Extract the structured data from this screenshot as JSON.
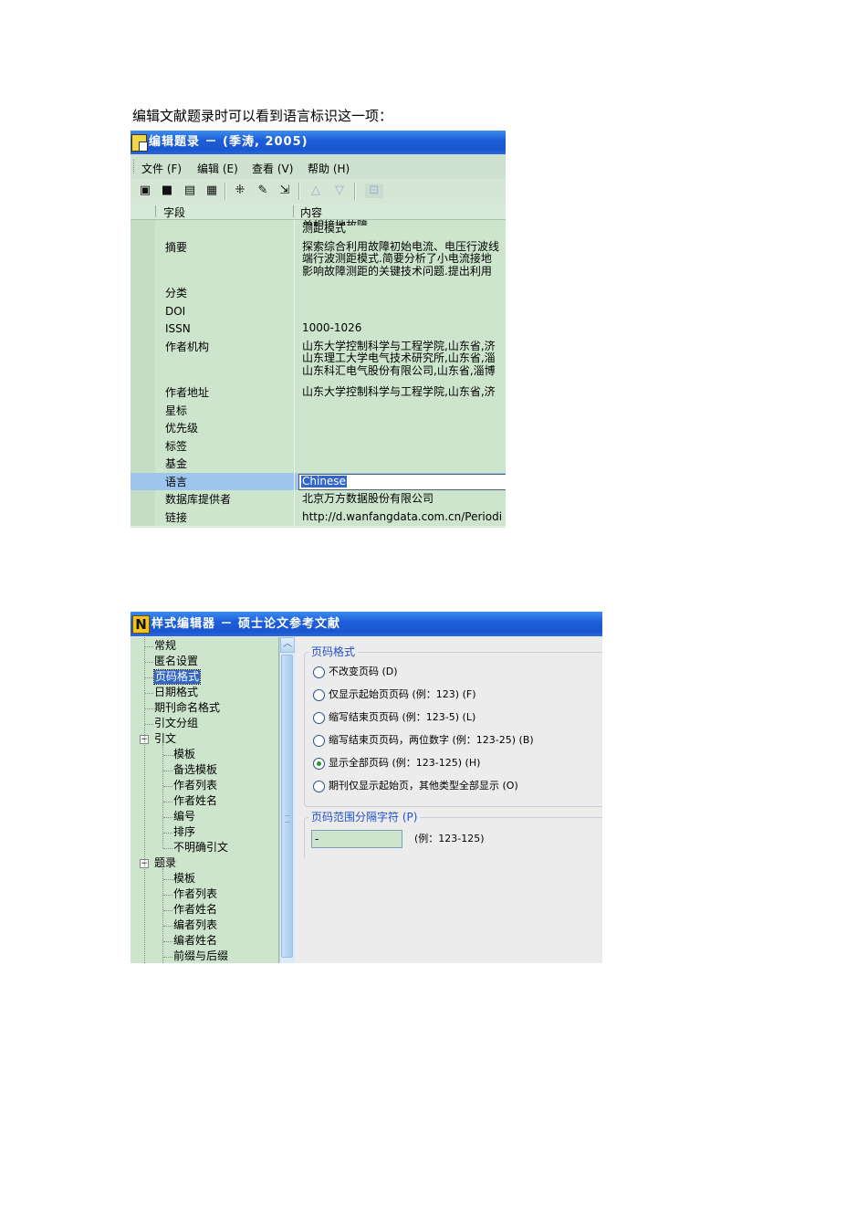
{
  "caption": "编辑文献题录时可以看到语言标识这一项：",
  "window1": {
    "title": "编辑题录 － (季涛, 2005)",
    "menu": [
      "文件 (F)",
      "编辑 (E)",
      "查看 (V)",
      "帮助 (H)"
    ],
    "toolbar_icons": [
      "save-record-icon",
      "save-icon",
      "copy-record-icon",
      "save-close-icon",
      "collapse-icon",
      "tools-icon",
      "export-icon",
      "up-arrow-icon",
      "down-arrow-icon",
      "disabled-button-icon"
    ],
    "columns": {
      "field": "字段",
      "content": "内容"
    },
    "cut_text": "单相接地故障",
    "rows": [
      {
        "field": "",
        "content": [
          "测距模式"
        ]
      },
      {
        "field": "摘要",
        "content": [
          "探索综合利用故障初始电流、电压行波线",
          "端行波测距模式.简要分析了小电流接地",
          "影响故障测距的关键技术问题.提出利用"
        ]
      },
      {
        "field": "分类",
        "content": []
      },
      {
        "field": "DOI",
        "content": []
      },
      {
        "field": "ISSN",
        "content": [
          "1000-1026"
        ]
      },
      {
        "field": "作者机构",
        "content": [
          "山东大学控制科学与工程学院,山东省,济",
          "山东理工大学电气技术研究所,山东省,淄",
          "山东科汇电气股份有限公司,山东省,淄博"
        ]
      },
      {
        "field": "作者地址",
        "content": [
          "山东大学控制科学与工程学院,山东省,济"
        ]
      },
      {
        "field": "星标",
        "content": []
      },
      {
        "field": "优先级",
        "content": []
      },
      {
        "field": "标签",
        "content": []
      },
      {
        "field": "基金",
        "content": []
      },
      {
        "field": "语言",
        "content": [],
        "selected": true,
        "edit_value": "Chinese"
      },
      {
        "field": "数据库提供者",
        "content": [
          "北京万方数据股份有限公司"
        ]
      },
      {
        "field": "链接",
        "content": [
          "http://d.wanfangdata.com.cn/Periodi"
        ]
      }
    ]
  },
  "window2": {
    "title": "样式编辑器 － 硕士论文参考文献",
    "tree": {
      "top_items": [
        "常规",
        "匿名设置",
        "页码格式",
        "日期格式",
        "期刊命名格式",
        "引文分组"
      ],
      "selected": "页码格式",
      "citation_label": "引文",
      "citation_children": [
        "模板",
        "备选模板",
        "作者列表",
        "作者姓名",
        "编号",
        "排序",
        "不明确引文"
      ],
      "bibliography_label": "题录",
      "bibliography_children": [
        "模板",
        "作者列表",
        "作者姓名",
        "编者列表",
        "编者姓名",
        "前缀与后缀"
      ]
    },
    "page_format_group": "页码格式",
    "radio_options": [
      {
        "label": "不改变页码 (D)",
        "checked": false
      },
      {
        "label": "仅显示起始页页码 (例：123) (F)",
        "checked": false
      },
      {
        "label": "缩写结束页页码 (例：123-5) (L)",
        "checked": false
      },
      {
        "label": "缩写结束页页码，两位数字 (例：123-25) (B)",
        "checked": false
      },
      {
        "label": "显示全部页码 (例：123-125) (H)",
        "checked": true
      },
      {
        "label": "期刊仅显示起始页，其他类型全部显示 (O)",
        "checked": false
      }
    ],
    "separator_group": "页码范围分隔字符 (P)",
    "separator_value": "-",
    "separator_example": "(例：123-125)"
  }
}
